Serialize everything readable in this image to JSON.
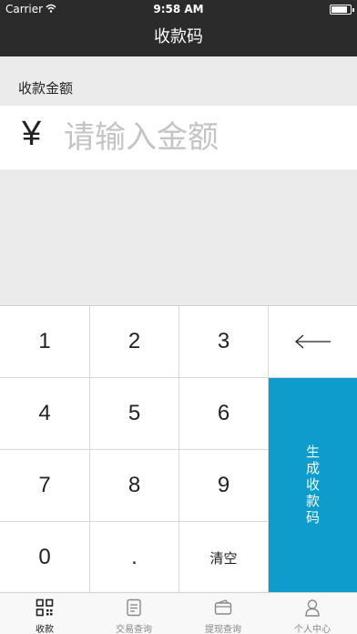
{
  "status_bar": {
    "carrier": "Carrier",
    "time": "9:58 AM"
  },
  "nav": {
    "title": "收款码"
  },
  "amount": {
    "label": "收款金额",
    "currency_symbol": "¥",
    "placeholder": "请输入金额",
    "value": ""
  },
  "keypad": {
    "keys": [
      "1",
      "2",
      "3",
      "4",
      "5",
      "6",
      "7",
      "8",
      "9",
      "0",
      "."
    ],
    "clear_label": "清空",
    "backspace_icon": "left-arrow",
    "generate_label": "生成收款码"
  },
  "tabs": [
    {
      "label": "收款",
      "icon": "qr-code-icon",
      "active": true
    },
    {
      "label": "交易查询",
      "icon": "document-icon",
      "active": false
    },
    {
      "label": "提现查询",
      "icon": "wallet-card-icon",
      "active": false
    },
    {
      "label": "个人中心",
      "icon": "person-icon",
      "active": false
    }
  ],
  "colors": {
    "accent": "#0d9ccb",
    "topbar": "#2b2b2b",
    "background": "#ebebeb"
  }
}
